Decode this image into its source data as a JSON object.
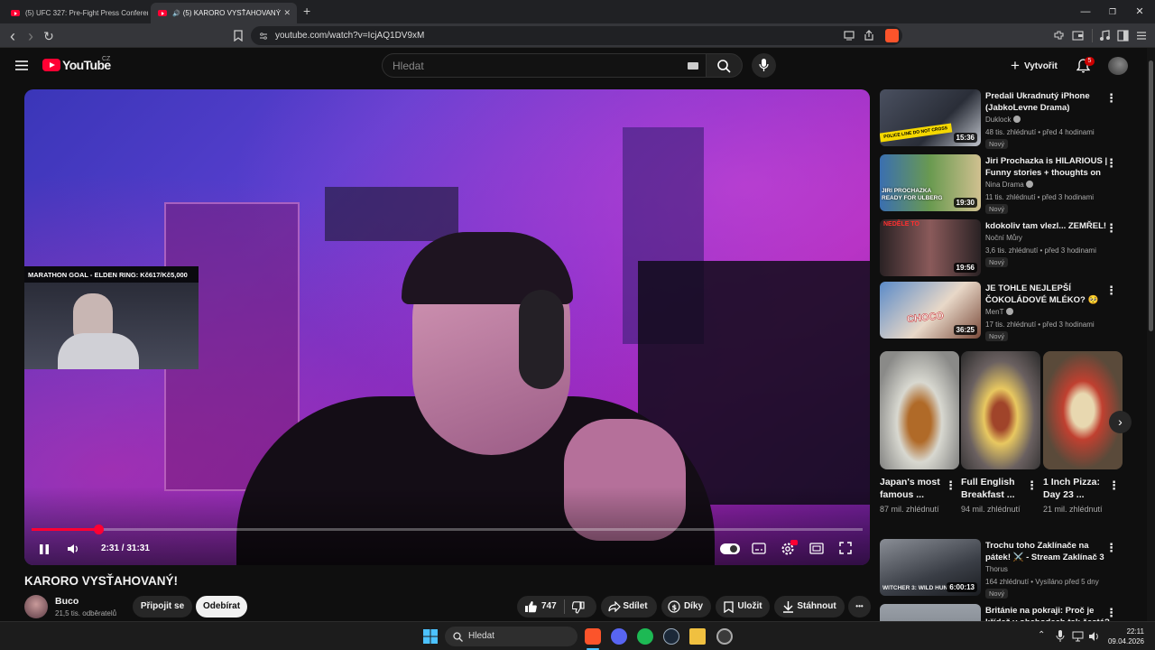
{
  "browser": {
    "tabs": [
      {
        "title": "(5) UFC 327: Pre-Fight Press Conferen",
        "active": false
      },
      {
        "title": "(5) KARORO VYSŤAHOVANÝ!",
        "active": true,
        "audio": "🔊"
      }
    ],
    "new_tab": "+",
    "url": "youtube.com/watch?v=IcjAQ1DV9xM",
    "window_controls": {
      "minimize": "—",
      "restore": "❐",
      "close": "✕"
    },
    "nav": {
      "back": "‹",
      "forward": "›",
      "reload": "↻"
    }
  },
  "header": {
    "logo_text": "YouTube",
    "region": "CZ",
    "search_placeholder": "Hledat",
    "create_label": "Vytvořit",
    "notif_count": "5"
  },
  "player": {
    "overlay_goal": "MARATHON GOAL - ELDEN RING: Kč617/Kč5,000",
    "time": "2:31 / 31:31",
    "progress": 0.08
  },
  "video": {
    "title": "KARORO VYSŤAHOVANÝ!",
    "channel": "Buco",
    "subscribers": "21,5 tis. odběratelů",
    "join_label": "Připojit se",
    "unsubscribe_label": "Odebírat",
    "likes": "747",
    "share_label": "Sdílet",
    "thanks_label": "Díky",
    "save_label": "Uložit",
    "download_label": "Stáhnout",
    "more_label": "•••"
  },
  "recommendations": [
    {
      "title": "Predali Ukradnutý iPhone (JabkoLevne Drama)",
      "channel": "Duklock",
      "meta": "48 tis. zhlédnutí • před 4 hodinami",
      "badge": "Nový",
      "duration": "15:36",
      "thumb_text": "POLICE LINE DO NOT CROSS"
    },
    {
      "title": "Jiri Prochazka is HILARIOUS | Funny stories + thoughts on …",
      "channel": "Nina Drama",
      "meta": "11 tis. zhlédnutí • před 3 hodinami",
      "badge": "Nový",
      "duration": "19:30",
      "thumb_text": "JIRI PROCHAZKA READY FOR ULBERG"
    },
    {
      "title": "kdokoliv tam vlezl... ZEMŘEL!",
      "channel": "Noční Můry",
      "meta": "3,6 tis. zhlédnutí • před 3 hodinami",
      "badge": "Nový",
      "duration": "19:56",
      "thumb_text": "NEDĚLE TO"
    },
    {
      "title": "JE TOHLE NEJLEPŠÍ ČOKOLÁDOVÉ MLÉKO? 🥺",
      "channel": "MenT",
      "meta": "17 tis. zhlédnutí • před 3 hodinami",
      "badge": "Nový",
      "duration": "36:25",
      "thumb_text": "CHOCO"
    },
    {
      "title": "Trochu toho Zaklínače na pátek! ⚔️ - Stream Zaklínač 3 CZ / …",
      "channel": "Thorus",
      "meta": "164 zhlédnutí • Vysíláno před 5 dny",
      "badge": "Nový",
      "duration": "6:00:13",
      "thumb_text": "WITCHER 3: WILD HUNT"
    },
    {
      "title": "Británie na pokraji: Proč je křídež v obchodech tak častá?",
      "channel": "",
      "meta": "",
      "badge": "",
      "duration": "",
      "thumb_text": ""
    }
  ],
  "shorts": [
    {
      "title": "Japan's most famous ...",
      "views": "87 mil. zhlédnutí"
    },
    {
      "title": "Full English Breakfast ...",
      "views": "94 mil. zhlédnutí"
    },
    {
      "title": "1 Inch Pizza: Day 23 ...",
      "views": "21 mil. zhlédnutí"
    }
  ],
  "taskbar": {
    "search_label": "Hledat",
    "time": "22:11",
    "date": "09.04.2026"
  }
}
